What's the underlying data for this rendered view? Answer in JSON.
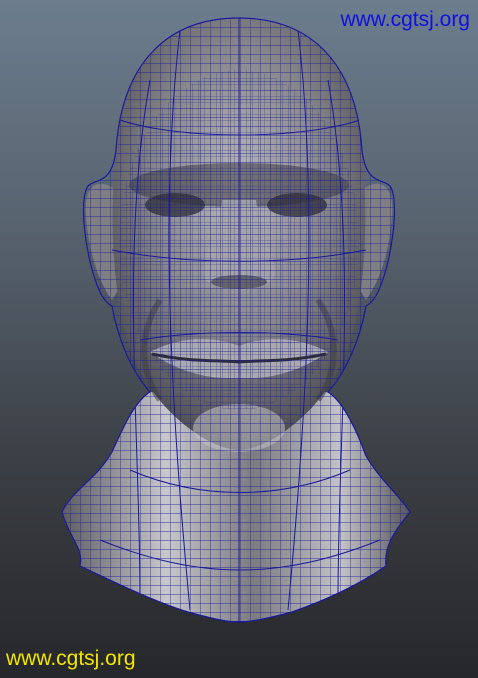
{
  "scene": {
    "subject": "wireframe-head-render",
    "background_top": "#6c7d8e",
    "background_bottom": "#26272a",
    "wire_color": "#1a1a9c",
    "skin_color": "#8f8f92"
  },
  "watermarks": {
    "top": {
      "text": "www.cgtsj.org",
      "color": "#1010e0"
    },
    "bottom": {
      "text": "www.cgtsj.org",
      "color": "#f2e600"
    }
  }
}
